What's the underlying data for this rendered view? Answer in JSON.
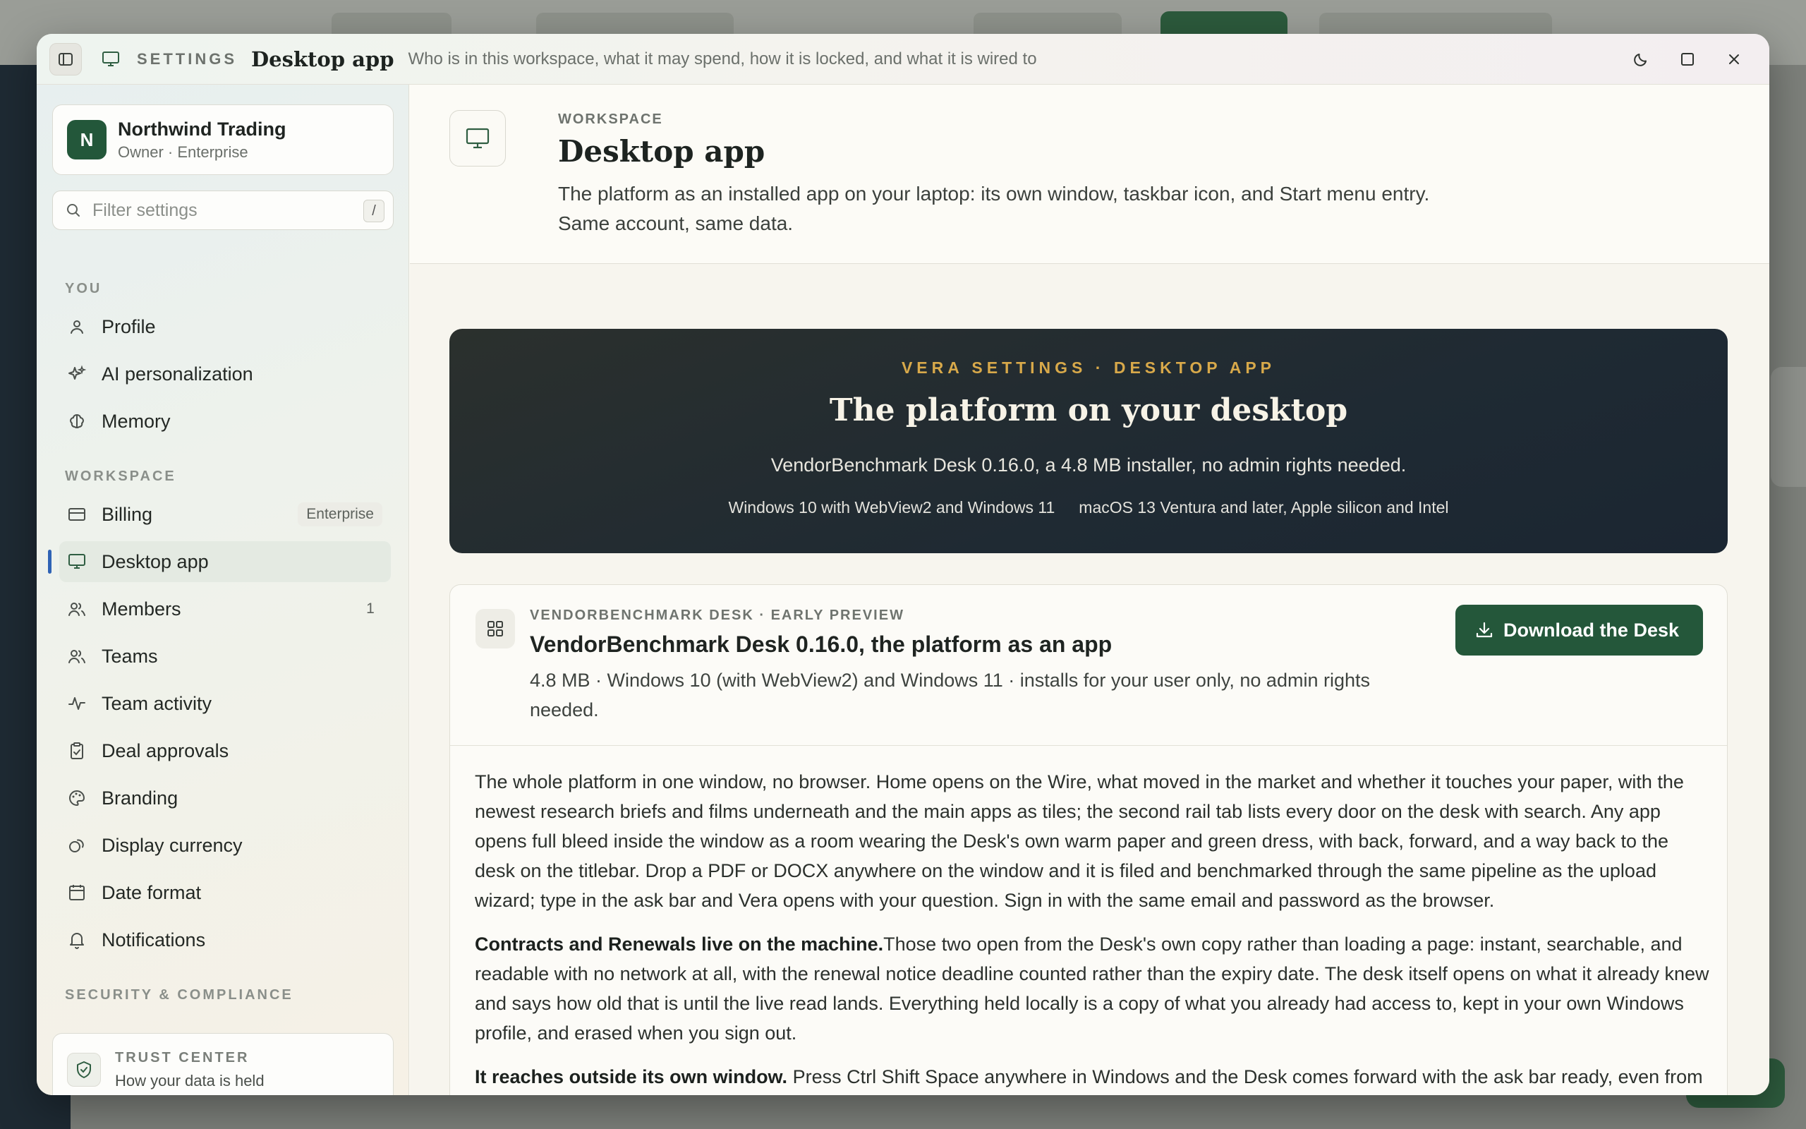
{
  "window": {
    "section_label": "SETTINGS",
    "title": "Desktop app",
    "subtitle": "Who is in this workspace, what it may spend, how it is locked, and what it is wired to"
  },
  "sidebar": {
    "org": {
      "initial": "N",
      "name": "Northwind Trading",
      "role": "Owner · Enterprise"
    },
    "filter": {
      "placeholder": "Filter settings",
      "shortcut": "/"
    },
    "sections": [
      {
        "label": "YOU"
      },
      {
        "label": "WORKSPACE"
      },
      {
        "label": "SECURITY & COMPLIANCE"
      }
    ],
    "items": [
      {
        "label": "Profile",
        "icon": "user-icon"
      },
      {
        "label": "AI personalization",
        "icon": "sparkles-icon"
      },
      {
        "label": "Memory",
        "icon": "brain-icon"
      },
      {
        "label": "Billing",
        "icon": "credit-card-icon",
        "badge": "Enterprise"
      },
      {
        "label": "Desktop app",
        "icon": "monitor-icon",
        "active": true
      },
      {
        "label": "Members",
        "icon": "users-icon",
        "count": "1"
      },
      {
        "label": "Teams",
        "icon": "users-icon"
      },
      {
        "label": "Team activity",
        "icon": "activity-icon"
      },
      {
        "label": "Deal approvals",
        "icon": "clipboard-check-icon"
      },
      {
        "label": "Branding",
        "icon": "palette-icon"
      },
      {
        "label": "Display currency",
        "icon": "coins-icon"
      },
      {
        "label": "Date format",
        "icon": "calendar-icon"
      },
      {
        "label": "Notifications",
        "icon": "bell-icon"
      }
    ],
    "trust": {
      "title": "TRUST CENTER",
      "subtitle": "How your data is held"
    }
  },
  "page": {
    "eyebrow": "WORKSPACE",
    "title": "Desktop app",
    "description": "The platform as an installed app on your laptop: its own window, taskbar icon, and Start menu entry. Same account, same data."
  },
  "hero": {
    "eyebrow": "VERA SETTINGS · DESKTOP APP",
    "title": "The platform on your desktop",
    "subtitle": "VendorBenchmark Desk 0.16.0, a 4.8 MB installer, no admin rights needed.",
    "platforms": [
      "Windows 10 with WebView2 and Windows 11",
      "macOS 13 Ventura and later, Apple silicon and Intel"
    ]
  },
  "download": {
    "eyebrow": "VENDORBENCHMARK DESK · EARLY PREVIEW",
    "title": "VendorBenchmark Desk 0.16.0, the platform as an app",
    "description": "4.8 MB · Windows 10 (with WebView2) and Windows 11 · installs for your user only, no admin rights needed.",
    "button_label": "Download the Desk",
    "body": [
      {
        "lead": "",
        "text": "The whole platform in one window, no browser. Home opens on the Wire, what moved in the market and whether it touches your paper, with the newest research briefs and films underneath and the main apps as tiles; the second rail tab lists every door on the desk with search. Any app opens full bleed inside the window as a room wearing the Desk's own warm paper and green dress, with back, forward, and a way back to the desk on the titlebar. Drop a PDF or DOCX anywhere on the window and it is filed and benchmarked through the same pipeline as the upload wizard; type in the ask bar and Vera opens with your question. Sign in with the same email and password as the browser."
      },
      {
        "lead": "Contracts and Renewals live on the machine.",
        "text": "Those two open from the Desk's own copy rather than loading a page: instant, searchable, and readable with no network at all, with the renewal notice deadline counted rather than the expiry date. The desk itself opens on what it already knew and says how old that is until the live read lands. Everything held locally is a copy of what you already had access to, kept in your own Windows profile, and erased when you sign out."
      },
      {
        "lead": "It reaches outside its own window.",
        "text": " Press Ctrl Shift Space anywhere in Windows and the Desk comes forward with the ask bar ready, even from the tray. Select text in any application, press Ctrl Shift A, and Vera opens with it as the question; your clipboard is put back exactly as it"
      }
    ]
  }
}
